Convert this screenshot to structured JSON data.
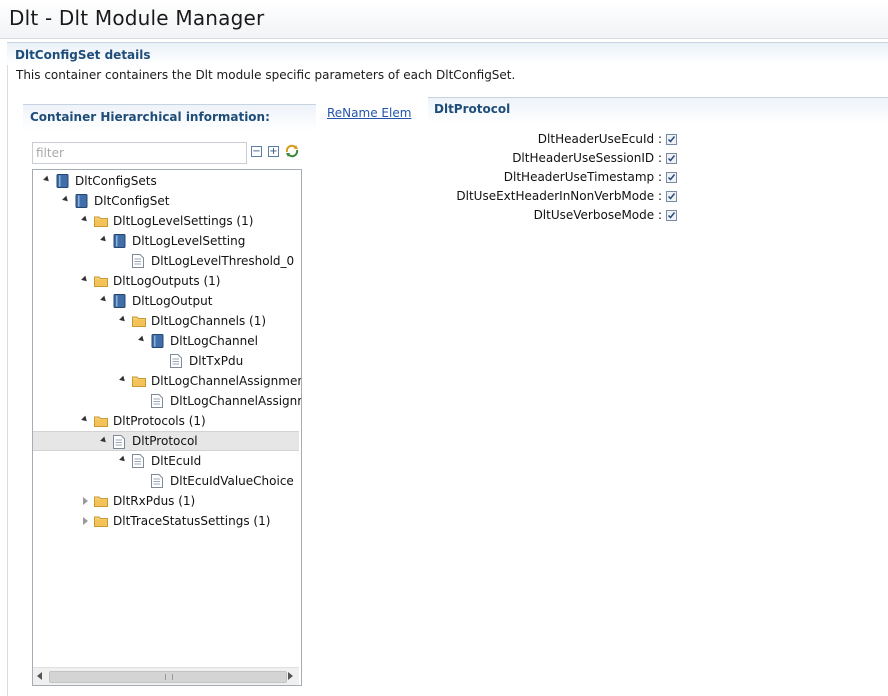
{
  "window": {
    "title": "Dlt - Dlt Module Manager"
  },
  "section": {
    "title": "DltConfigSet details",
    "description": "This container containers the Dlt module specific parameters of each DltConfigSet."
  },
  "left_panel": {
    "title": "Container Hierarchical information:",
    "rename_link": "ReName Elem",
    "filter_placeholder": "filter"
  },
  "tree": [
    {
      "label": "DltConfigSets",
      "icon": "module-icon",
      "toggle": "open"
    },
    {
      "label": "DltConfigSet",
      "icon": "module-icon",
      "toggle": "open"
    },
    {
      "label": "DltLogLevelSettings (1)",
      "icon": "folder-icon",
      "toggle": "open"
    },
    {
      "label": "DltLogLevelSetting",
      "icon": "module-icon",
      "toggle": "open"
    },
    {
      "label": "DltLogLevelThreshold_0",
      "icon": "document-icon",
      "toggle": "none"
    },
    {
      "label": "DltLogOutputs (1)",
      "icon": "folder-icon",
      "toggle": "open"
    },
    {
      "label": "DltLogOutput",
      "icon": "module-icon",
      "toggle": "open"
    },
    {
      "label": "DltLogChannels (1)",
      "icon": "folder-icon",
      "toggle": "open"
    },
    {
      "label": "DltLogChannel",
      "icon": "module-icon",
      "toggle": "open"
    },
    {
      "label": "DltTxPdu",
      "icon": "document-icon",
      "toggle": "none"
    },
    {
      "label": "DltLogChannelAssignmen",
      "icon": "folder-icon",
      "toggle": "open"
    },
    {
      "label": "DltLogChannelAssignm",
      "icon": "document-icon",
      "toggle": "none"
    },
    {
      "label": "DltProtocols (1)",
      "icon": "folder-icon",
      "toggle": "open"
    },
    {
      "label": "DltProtocol",
      "icon": "document-icon",
      "toggle": "open",
      "selected": true
    },
    {
      "label": "DltEcuId",
      "icon": "document-icon",
      "toggle": "open"
    },
    {
      "label": "DltEcuIdValueChoice",
      "icon": "document-icon",
      "toggle": "none"
    },
    {
      "label": "DltRxPdus (1)",
      "icon": "folder-icon",
      "toggle": "closed"
    },
    {
      "label": "DltTraceStatusSettings (1)",
      "icon": "folder-icon",
      "toggle": "closed"
    }
  ],
  "right_panel": {
    "title": "DltProtocol",
    "params": [
      {
        "label": "DltHeaderUseEcuId :",
        "checked": true
      },
      {
        "label": "DltHeaderUseSessionID :",
        "checked": true
      },
      {
        "label": "DltHeaderUseTimestamp :",
        "checked": true
      },
      {
        "label": "DltUseExtHeaderInNonVerbMode :",
        "checked": true
      },
      {
        "label": "DltUseVerboseMode :",
        "checked": true
      }
    ]
  },
  "colors": {
    "header_text": "#1f4d7a",
    "link": "#2255aa",
    "selection": "#e6e6e6",
    "folder": "#f3c35a",
    "module": "#3f6ea8"
  }
}
